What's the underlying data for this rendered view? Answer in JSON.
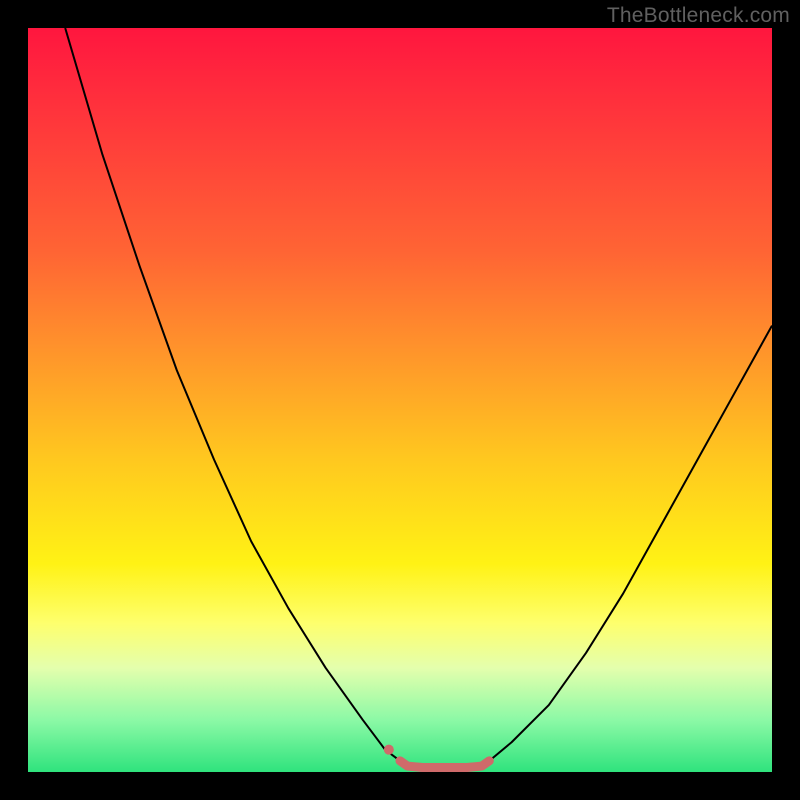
{
  "watermark": "TheBottleneck.com",
  "chart_data": {
    "type": "line",
    "title": "",
    "xlabel": "",
    "ylabel": "",
    "xlim": [
      0,
      100
    ],
    "ylim": [
      0,
      100
    ],
    "background_gradient": {
      "direction": "vertical",
      "stops": [
        {
          "pos": 0.0,
          "color": "#ff163e"
        },
        {
          "pos": 0.08,
          "color": "#ff2b3d"
        },
        {
          "pos": 0.3,
          "color": "#ff6434"
        },
        {
          "pos": 0.42,
          "color": "#ff8f2c"
        },
        {
          "pos": 0.58,
          "color": "#ffc81f"
        },
        {
          "pos": 0.72,
          "color": "#fff215"
        },
        {
          "pos": 0.8,
          "color": "#feff6d"
        },
        {
          "pos": 0.86,
          "color": "#e4ffad"
        },
        {
          "pos": 0.93,
          "color": "#8cf9a6"
        },
        {
          "pos": 1.0,
          "color": "#2fe37d"
        }
      ]
    },
    "series": [
      {
        "name": "left-curve",
        "color": "#000000",
        "width": 2,
        "x": [
          5,
          10,
          15,
          20,
          25,
          30,
          35,
          40,
          45,
          48,
          50
        ],
        "y": [
          100,
          83,
          68,
          54,
          42,
          31,
          22,
          14,
          7,
          3,
          1.5
        ]
      },
      {
        "name": "right-curve",
        "color": "#000000",
        "width": 2,
        "x": [
          62,
          65,
          70,
          75,
          80,
          85,
          90,
          95,
          100
        ],
        "y": [
          1.5,
          4,
          9,
          16,
          24,
          33,
          42,
          51,
          60
        ]
      },
      {
        "name": "bottom-flat",
        "color": "#cf6a6a",
        "width": 9,
        "linecap": "round",
        "x": [
          50,
          51,
          53,
          55,
          57,
          59,
          61,
          62
        ],
        "y": [
          1.5,
          0.8,
          0.6,
          0.6,
          0.6,
          0.6,
          0.8,
          1.5
        ]
      },
      {
        "name": "left-dot",
        "type": "marker",
        "color": "#cf6a6a",
        "radius": 5,
        "x": [
          48.5
        ],
        "y": [
          3
        ]
      }
    ]
  }
}
